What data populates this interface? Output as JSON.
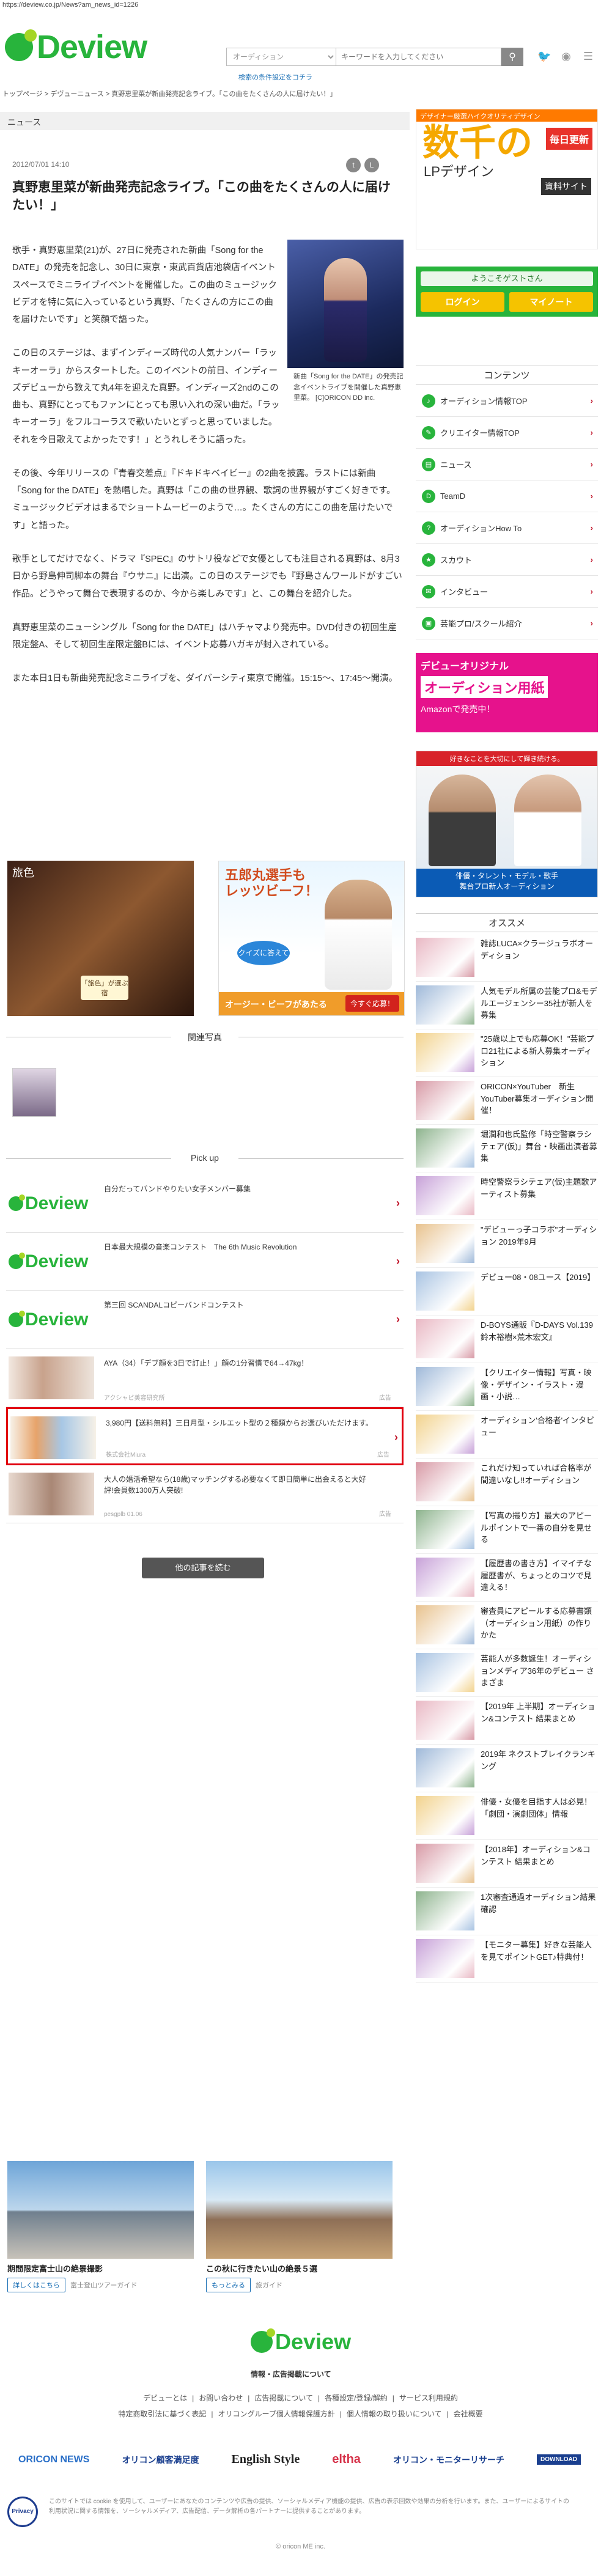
{
  "browser": {
    "url": "https://deview.co.jp/News?am_news_id=1226"
  },
  "header": {
    "logo_text": "Deview",
    "search_category_placeholder": "オーディション",
    "search_keyword_placeholder": "キーワードを入力してください",
    "search_condition_link": "検索の条件設定をコチラ"
  },
  "breadcrumb": "トップページ > デヴューニュース > 真野恵里菜が新曲発売記念ライブ。「この曲をたくさんの人に届けたい！」",
  "section_title": "ニュース",
  "article": {
    "date": "2012/07/01 14:10",
    "title": "真野恵里菜が新曲発売記念ライブ。「この曲をたくさんの人に届けたい！」",
    "photo_caption": "新曲「Song for the DATE」の発売記念イベントライブを開催した真野恵里菜。 [C]ORICON DD inc.",
    "paragraphs": [
      "歌手・真野恵里菜(21)が、27日に発売された新曲「Song for the DATE」の発売を記念し、30日に東京・東武百貨店池袋店イベントスペースでミニライブイベントを開催した。この曲のミュージックビデオを特に気に入っているという真野、「たくさんの方にこの曲を届けたいです」と笑顔で語った。",
      "この日のステージは、まずインディーズ時代の人気ナンバー「ラッキーオーラ」からスタートした。このイベントの前日、インディーズデビューから数えて丸4年を迎えた真野。インディーズ2ndのこの曲も、真野にとってもファンにとっても思い入れの深い曲だ。「ラッキーオーラ」をフルコーラスで歌いたいとずっと思っていました。それを今日歌えてよかったです！」とうれしそうに語った。",
      "その後、今年リリースの『青春交差点』『ドキドキベイビー』の2曲を披露。ラストには新曲「Song for the DATE」を熱唱した。真野は「この曲の世界観、歌詞の世界観がすごく好きです。ミュージックビデオはまるでショートムービーのようで…。たくさんの方にこの曲を届けたいです」と語った。",
      "歌手としてだけでなく、ドラマ『SPEC』のサトリ役などで女優としても注目される真野は、8月3日から野島伸司脚本の舞台『ウサニ』に出演。この日のステージでも『野島さんワールドがすごい作品。どうやって舞台で表現するのか、今から楽しみです』と、この舞台を紹介した。",
      "真野恵里菜のニューシングル「Song for the DATE」はハチャマより発売中。DVD付きの初回生産限定盤A、そして初回生産限定盤Bには、イベント応募ハガキが封入されている。",
      "また本日1日も新曲発売記念ミニライブを、ダイバーシティ東京で開催。15:15〜、17:45〜開演。"
    ]
  },
  "ads": {
    "ad1_label": "旅色",
    "ad1_badge": "「旅色」が選ぶ宿",
    "ad2_head": "五郎丸選手も\nレッツビーフ！",
    "ad2_quiz": "クイズに答えて",
    "ad2_foot": "オージー・ビーフがあたる",
    "ad2_btn": "今すぐ応募！"
  },
  "related": {
    "title": "関連写真"
  },
  "pickup": {
    "title": "Pick up",
    "items": [
      {
        "type": "logo",
        "text": "自分だってバンドやりたい女子メンバー募集",
        "meta": "",
        "tag": ""
      },
      {
        "type": "logo",
        "text": "日本最大規模の音楽コンテスト　The 6th Music Revolution",
        "meta": "",
        "tag": ""
      },
      {
        "type": "logo",
        "text": "第三回 SCANDALコピーバンドコンテスト",
        "meta": "",
        "tag": ""
      },
      {
        "type": "img",
        "text": "AYA（34）「デブ顔を3日で訂止！」顔の1分習慣で64→47kg！",
        "meta": "アクシャビ美容研究所",
        "tag": "広告"
      },
      {
        "type": "img",
        "text": "3,980円【送料無料】三日月型・シルエット型の２種類からお選びいただけます。",
        "meta": "株式会社Miura",
        "tag": "広告"
      },
      {
        "type": "img",
        "text": "大人の婚活希望なら(18歳)マッチングする必要なくて即日簡単に出会えると大好評!会員数1300万人突破!",
        "meta": "pesgplb 01.06",
        "tag": "広告"
      }
    ],
    "more_button": "他の記事を読む"
  },
  "bottom_ads": [
    {
      "title": "期間限定富士山の絶景撮影",
      "btn": "詳しくはこちら",
      "src": "富士登山ツアーガイド"
    },
    {
      "title": "この秋に行きたい山の絶景５選",
      "btn": "もっとみる",
      "src": "旅ガイド"
    }
  ],
  "sidebar": {
    "ad_top": "デザイナー厳選ハイクオリティデザイン",
    "ad_big": "数千の",
    "ad_lp": "LPデザイン",
    "ad_badge": "毎日更新",
    "ad_sub": "資料サイト",
    "welcome": "ようこそゲストさん",
    "login": "ログイン",
    "mypage": "マイノート",
    "content_title": "コンテンツ",
    "menu": [
      "オーディション情報TOP",
      "クリエイター情報TOP",
      "ニュース",
      "TeamD",
      "オーディションHow To",
      "スカウト",
      "インタビュー",
      "芸能プロ/スクール紹介"
    ],
    "ad2_a": "デビューオリジナル",
    "ad2_b": "オーディション用紙",
    "ad2_c": "Amazonで発売中！",
    "ad3_top": "好きなことを大切にして輝き続ける。",
    "ad3_foot": "俳優・タレント・モデル・歌手\n舞台プロ新人オーディション",
    "osusume_title": "オススメ",
    "list": [
      "雑誌LUCA×クラージュラボオーディション",
      "人気モデル所属の芸能プロ&モデルエージェンシー35社が新人を募集",
      "\"25歳以上でも応募OK！\"芸能プロ21社による新人募集オーディション",
      "ORICON×YouTuber　新生YouTuber募集オーディション開催！",
      "堀潤和也氏監修「時空警察ラシテェア(仮)」舞台・映画出演者募集",
      "時空警察ラシテェア(仮)主題歌アーティスト募集",
      "\"デビューっ子コラボ\"オーディション 2019年9月",
      "デビュー08・08ユース【2019】",
      "D-BOYS通販『D-DAYS Vol.139 鈴木裕樹×荒木宏文』",
      "【クリエイター情報】写真・映像・デザイン・イラスト・漫画・小説…",
      "オーディション'合格者'インタビュー",
      "これだけ知っていれば合格率が間違いなし!!オーディション",
      "【写真の撮り方】最大のアピールポイントで一番の自分を見せる",
      "【履歴書の書き方】イマイチな履歴書が、ちょっとのコツで見違える！",
      "審査員にアピールする応募書類（オーディション用紙）の作りかた",
      "芸能人が多数誕生！オーディションメディア36年のデビュー さまざま",
      "【2019年 上半期】オーディション&コンテスト 結果まとめ",
      "2019年 ネクストブレイクランキング",
      "俳優・女優を目指す人は必見！「劇団・演劇団体」情報",
      "【2018年】オーディション&コンテスト 結果まとめ",
      "1次審査通過オーディション結果確認",
      "【モニター募集】好きな芸能人を見てポイントGET♪特典付！"
    ]
  },
  "footer": {
    "logo_text": "Deview",
    "sub": "情報・広告掲載について",
    "links1": [
      "デビューとは",
      "お問い合わせ",
      "広告掲載について",
      "各種設定/登録/解約",
      "サービス利用規約"
    ],
    "links2": [
      "特定商取引法に基づく表記",
      "オリコングループ個人情報保護方針",
      "個人情報の取り扱いについて",
      "会社概要"
    ],
    "brands": [
      "ORICON NEWS",
      "オリコン顧客満足度",
      "English Style",
      "eltha",
      "オリコン・モニターリサーチ",
      "DOWNLOAD"
    ],
    "seal": "Privacy",
    "note": "このサイトでは cookie を使用して、ユーザーにあなたのコンテンツや広告の提供、ソーシャルメディア機能の提供、広告の表示回数や効果の分析を行います。また、ユーザーによるサイトの利用状況に関する情報を、ソーシャルメディア、広告配信、データ解析の各パートナーに提供することがあります。",
    "copy": "© oricon ME inc."
  },
  "colors": {
    "brand": "#28b43c",
    "accent": "#c0152a",
    "highlight": "#e1000f"
  }
}
